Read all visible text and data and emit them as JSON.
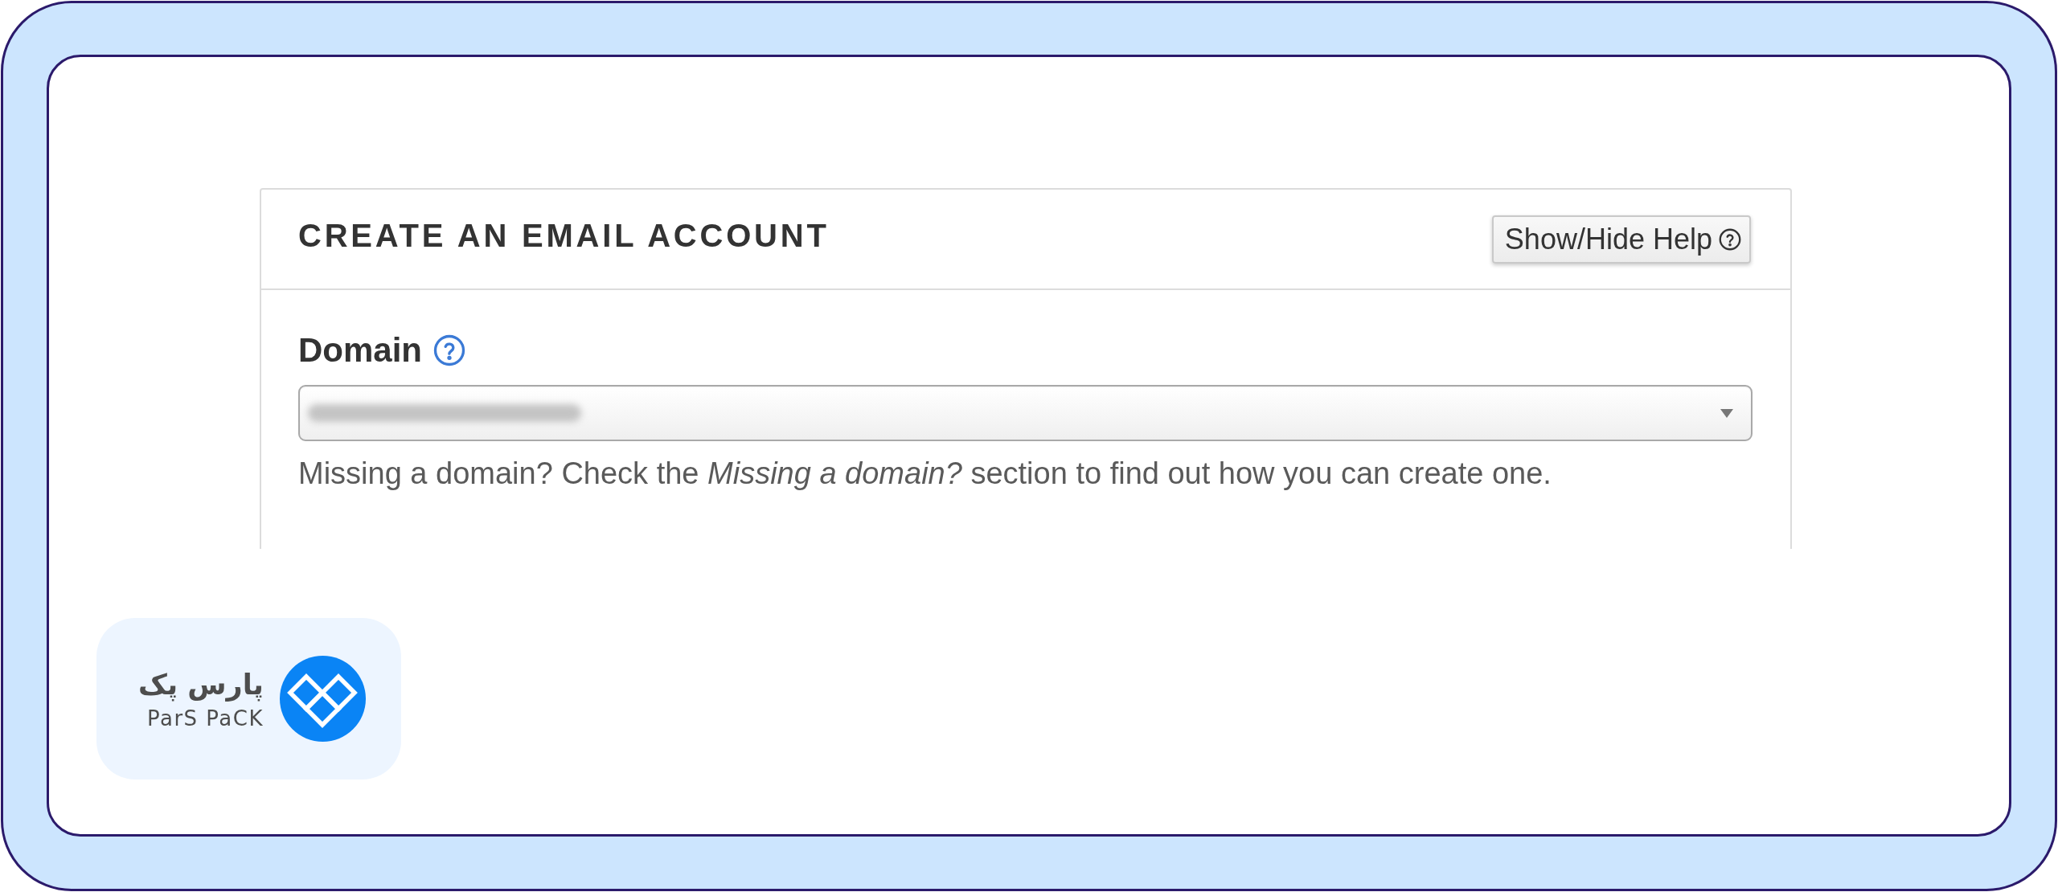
{
  "card": {
    "title": "CREATE AN EMAIL ACCOUNT",
    "help_button": {
      "label": "Show/Hide Help"
    }
  },
  "domain_field": {
    "label": "Domain",
    "hint": "Missing a domain? Check the *Missing a domain?* section to find out how you can create one."
  },
  "logo": {
    "name_fa": "پارس پک",
    "name_en": "ParS PaCK"
  }
}
